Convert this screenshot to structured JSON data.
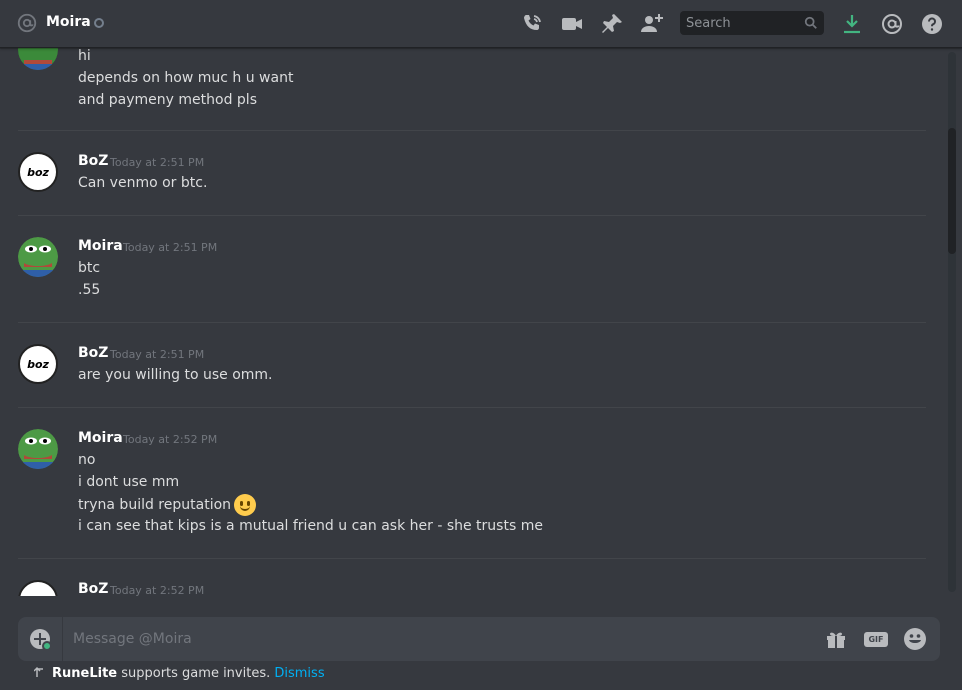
{
  "header": {
    "title": "Moira",
    "search_placeholder": "Search"
  },
  "messages": {
    "partial_first": {
      "lines": [
        "hi",
        "depends on how muc h u want",
        "and paymeny method pls"
      ]
    },
    "groups": [
      {
        "author": "BoZ",
        "timestamp": "Today at 2:51 PM",
        "lines": [
          "Can venmo or btc."
        ]
      },
      {
        "author": "Moira",
        "timestamp": "Today at 2:51 PM",
        "lines": [
          "btc",
          ".55"
        ]
      },
      {
        "author": "BoZ",
        "timestamp": "Today at 2:51 PM",
        "lines": [
          "are you willing to use omm."
        ]
      },
      {
        "author": "Moira",
        "timestamp": "Today at 2:52 PM",
        "lines": [
          "no",
          "i dont use mm",
          "tryna build reputation",
          "i can see that kips is a mutual friend u can ask her - she trusts me"
        ]
      },
      {
        "author": "BoZ",
        "timestamp": "Today at 2:52 PM",
        "lines": []
      }
    ],
    "boz_avatar_text": "boz"
  },
  "composer": {
    "placeholder": "Message @Moira",
    "gif_label": "GIF"
  },
  "notice": {
    "app_name": "RuneLite",
    "text": " supports game invites. ",
    "dismiss_label": "Dismiss"
  },
  "colors": {
    "background": "#36393f",
    "input": "#40444b",
    "accent_link": "#00b0f4",
    "download_green": "#43b581"
  },
  "icons": [
    "at-icon",
    "status-offline-icon",
    "call-icon",
    "video-icon",
    "pin-icon",
    "add-friend-icon",
    "search-icon",
    "download-icon",
    "mention-icon",
    "help-icon",
    "upload-plus-icon",
    "gift-icon",
    "gif-icon",
    "emoji-icon",
    "smile-emoji"
  ]
}
